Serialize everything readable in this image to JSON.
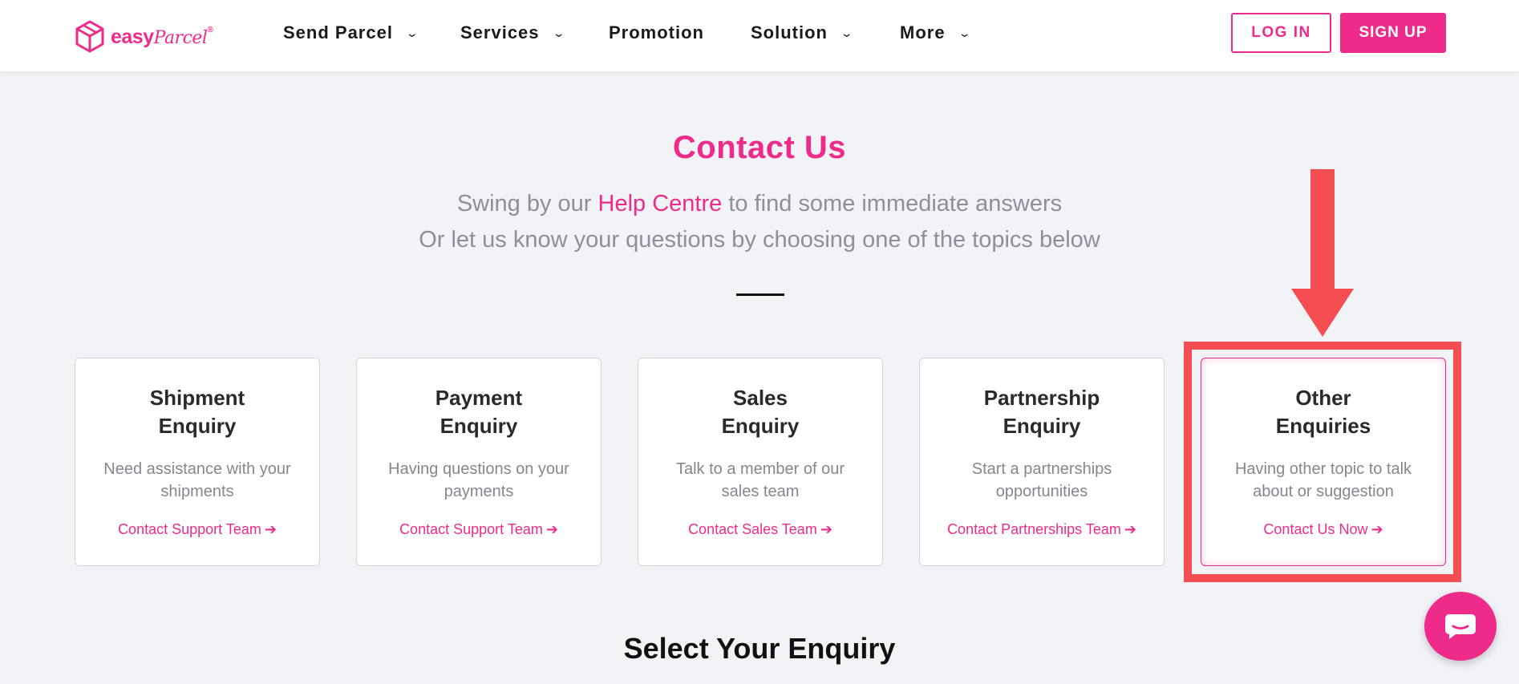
{
  "brand": {
    "logo_text": "easy",
    "logo_script": "Parcel",
    "logo_reg": "®",
    "accent": "#ee2b8a",
    "annotation": "#f54e52"
  },
  "nav": {
    "items": [
      {
        "label": "Send Parcel",
        "dropdown": true
      },
      {
        "label": "Services",
        "dropdown": true
      },
      {
        "label": "Promotion",
        "dropdown": false
      },
      {
        "label": "Solution",
        "dropdown": true
      },
      {
        "label": "More",
        "dropdown": true
      }
    ],
    "login_label": "LOG IN",
    "signup_label": "SIGN UP"
  },
  "hero": {
    "title": "Contact Us",
    "line1_prefix": "Swing by our ",
    "line1_link": "Help Centre",
    "line1_suffix": " to find some immediate answers",
    "line2": "Or let us know your questions by choosing one of the topics below"
  },
  "cards": [
    {
      "title_1": "Shipment",
      "title_2": "Enquiry",
      "desc_1": "Need assistance with your",
      "desc_2": "shipments",
      "link": "Contact Support Team"
    },
    {
      "title_1": "Payment",
      "title_2": "Enquiry",
      "desc_1": "Having questions on your",
      "desc_2": "payments",
      "link": "Contact Support Team"
    },
    {
      "title_1": "Sales",
      "title_2": "Enquiry",
      "desc_1": "Talk to a member of our",
      "desc_2": "sales team",
      "link": "Contact Sales Team"
    },
    {
      "title_1": "Partnership",
      "title_2": "Enquiry",
      "desc_1": "Start a partnerships",
      "desc_2": "opportunities",
      "link": "Contact Partnerships Team"
    },
    {
      "title_1": "Other",
      "title_2": "Enquiries",
      "desc_1": "Having other topic to talk",
      "desc_2": "about or suggestion",
      "link": "Contact Us Now"
    }
  ],
  "section_title": "Select Your Enquiry",
  "icons": {
    "chevron": "chevron-down-icon",
    "arrow": "arrow-right-icon",
    "chat": "chat-icon",
    "logo": "box-icon"
  }
}
